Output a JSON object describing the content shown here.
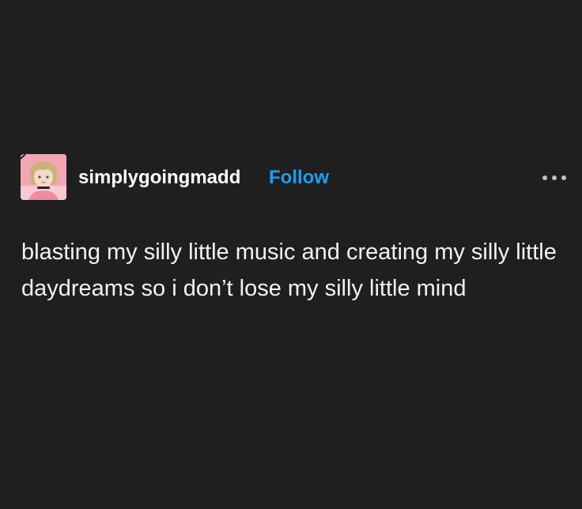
{
  "post": {
    "author": {
      "username": "simplygoingmadd",
      "avatar_icon": "anime-avatar-icon"
    },
    "follow_label": "Follow",
    "more_icon": "more-dots-icon",
    "content": "blasting my silly little music and creating my silly little daydreams so i don’t lose my silly little mind"
  },
  "colors": {
    "background": "#1f1f1f",
    "text": "#ffffff",
    "accent": "#1e9df0",
    "avatar_bg": "#f3a6b4"
  }
}
